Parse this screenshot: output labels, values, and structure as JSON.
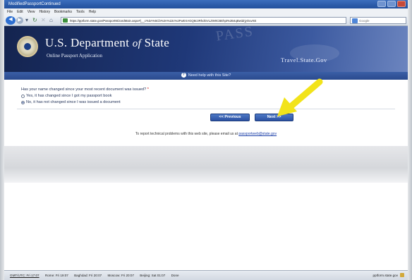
{
  "browser": {
    "window_title": "ModifiedPassportContinued",
    "menu": [
      "File",
      "Edit",
      "View",
      "History",
      "Bookmarks",
      "Tools",
      "Help"
    ],
    "url": "https://pptform.state.gov/PassportWizardMain.aspx#(__c%3A%5Cb%3A%22c%2FwEXAGQ8c3RhdGVLZW0CBEhpt%2B4qBwidrjyOuvXE",
    "search_placeholder": "Google"
  },
  "banner": {
    "department_part1": "U.S. Department",
    "department_of": "of",
    "department_part2": "State",
    "subtitle": "Online Passport Application",
    "site": "Travel.State.Gov",
    "watermark": "PASS"
  },
  "help": {
    "label": "Need help with this Site?"
  },
  "form": {
    "question": "Has your name changed since your most recent document was issued?",
    "required_mark": "*",
    "option_yes": "Yes, it has changed since I got my passport book",
    "option_no": "No, it has not changed since I was issued a document",
    "selected": "no",
    "prev_label": "<< Previous",
    "next_label": "Next >>"
  },
  "report": {
    "text": "To report technical problems with this web site, please email us at",
    "email": "passportweb@state.gov"
  },
  "status": {
    "clocks": [
      "GMT/UTC: Fri 17:07",
      "Rome: Fri 19:07",
      "Baghdad: Fri 20:07",
      "Moscow: Fri 20:07",
      "Beijing: Sat 01:07",
      "Done"
    ],
    "host": "pptform.state.gov"
  },
  "colors": {
    "arrow": "#f2e31a",
    "banner": "#1f3878"
  }
}
